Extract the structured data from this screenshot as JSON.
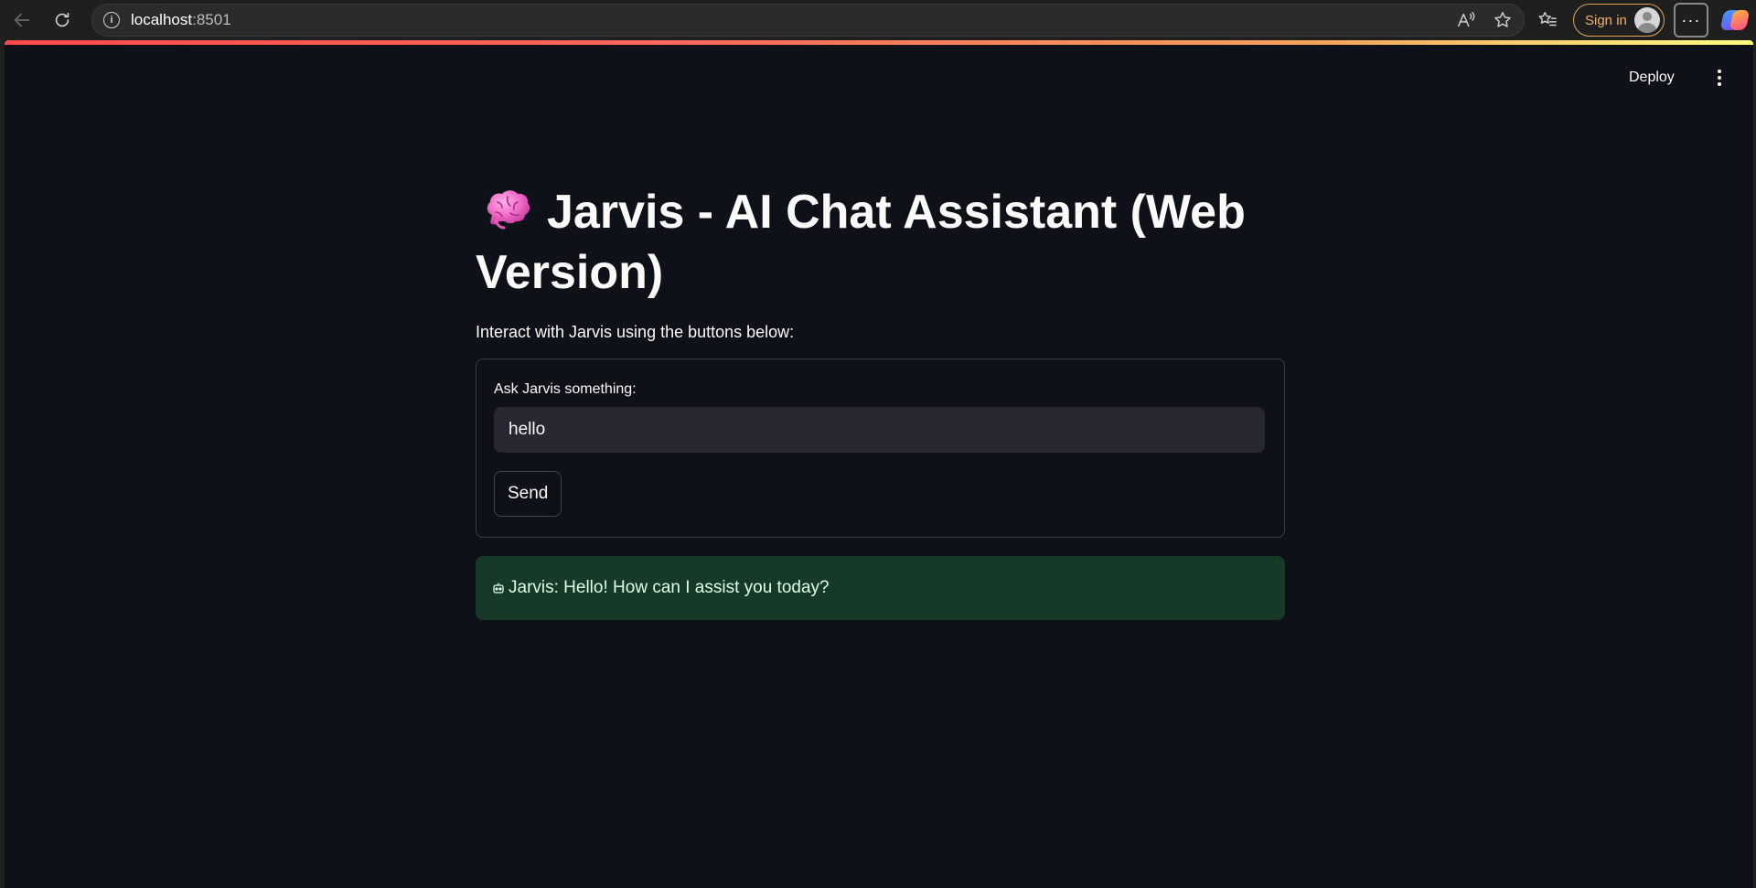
{
  "browser": {
    "url_host": "localhost",
    "url_port": ":8501",
    "sign_in_label": "Sign in",
    "more_label": "···"
  },
  "app": {
    "deploy_label": "Deploy",
    "title": "Jarvis - AI Chat Assistant (Web Version)",
    "caption": "Interact with Jarvis using the buttons below:",
    "form": {
      "input_label": "Ask Jarvis something:",
      "input_value": "hello",
      "send_label": "Send"
    },
    "response": "Jarvis: Hello! How can I assist you today?"
  },
  "colors": {
    "app_background": "#0e1117",
    "input_background": "#262730",
    "success_background": "#173928",
    "success_text": "#dffde9",
    "header_gradient_start": "#ff4b4b",
    "header_gradient_end": "#fffd80"
  },
  "icons": {
    "title_icon": "brain-icon",
    "response_icon": "robot-icon"
  }
}
